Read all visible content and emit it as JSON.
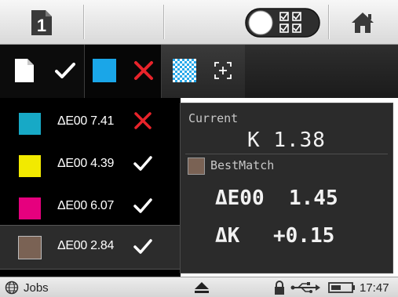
{
  "toolbar": {
    "job_icon": "job-document-icon",
    "job_number": "1",
    "toggle_icon": "compare-toggle-icon",
    "home_icon": "home-icon"
  },
  "tabs": {
    "sample_icon": "sample-page-icon",
    "sample_status_icon": "check-icon",
    "current_swatch_color": "#1aa6e8",
    "current_status_icon": "x-icon",
    "preview_icon": "checkerboard-icon",
    "focus_icon": "focus-plus-icon"
  },
  "list": {
    "items": [
      {
        "swatch_color": "#17a9c6",
        "label": "ΔE00 7.41",
        "status": "fail"
      },
      {
        "swatch_color": "#f2ea00",
        "label": "ΔE00 4.39",
        "status": "pass"
      },
      {
        "swatch_color": "#e6007e",
        "label": "ΔE00 6.07",
        "status": "pass"
      },
      {
        "swatch_color": "#7a6254",
        "label": "ΔE00 2.84",
        "status": "pass",
        "selected": true
      }
    ]
  },
  "detail": {
    "current_label": "Current",
    "current_value": "K 1.38",
    "bestmatch_label": "BestMatch",
    "bestmatch_swatch_color": "#7a6254",
    "delta_e_label": "ΔE00",
    "delta_e_value": "1.45",
    "delta_k_label": "ΔK",
    "delta_k_value": "+0.15"
  },
  "statusbar": {
    "jobs_icon": "globe-icon",
    "jobs_label": "Jobs",
    "eject_icon": "eject-icon",
    "lock_icon": "lock-icon",
    "usb_icon": "usb-icon",
    "battery_icon": "battery-icon",
    "time": "17:47"
  },
  "colors": {
    "pass": "#ffffff",
    "fail": "#e8232a"
  }
}
